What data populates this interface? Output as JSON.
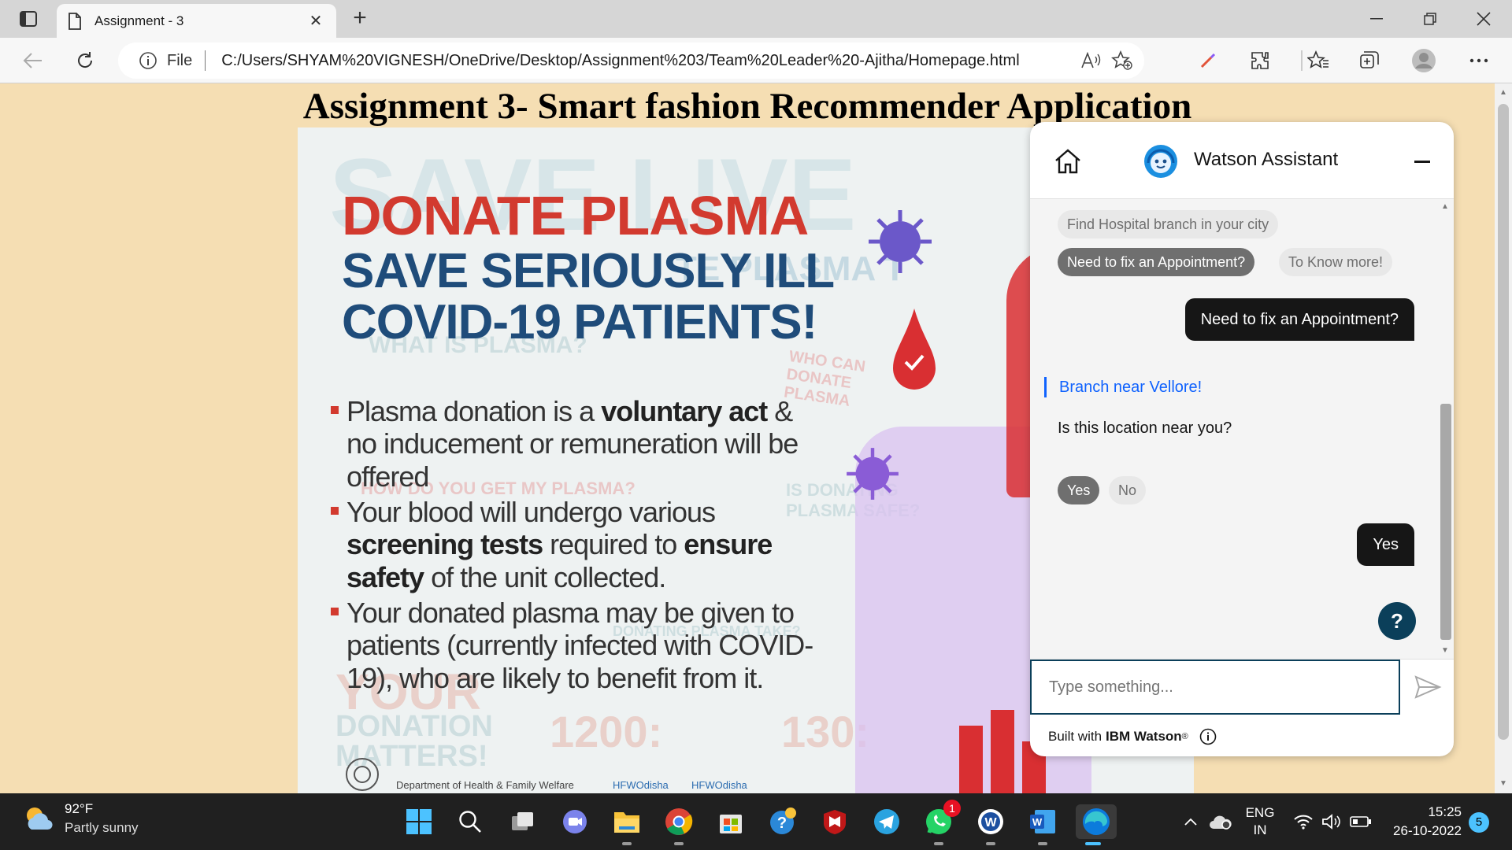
{
  "browser": {
    "tab_title": "Assignment - 3",
    "tab_close": "✕",
    "new_tab": "+",
    "file_label": "File",
    "url": "C:/Users/SHYAM%20VIGNESH/OneDrive/Desktop/Assignment%203/Team%20Leader%20-Ajitha/Homepage.html"
  },
  "page": {
    "title": "Assignment 3- Smart fashion Recommender Application"
  },
  "poster": {
    "bg_word": "SAVE LIVE",
    "headline_1": "DONATE PLASMA",
    "headline_2_line1": "SAVE SERIOUSLY ILL",
    "headline_2_line2": "COVID-19 PATIENTS!",
    "faded_1": "WHAT IS PLASMA?",
    "faded_2": "HOW DO YOU GET MY PLASMA?",
    "faded_3": "WHO CAN DONATE PLASMA",
    "faded_4": "IS DONATING PLASMA SAFE?",
    "faded_5": "YOUR",
    "faded_6": "DONATION",
    "faded_7": "MATTERS!",
    "faded_8": "1200:",
    "faded_9": "130:",
    "faded_10": "TE PLASMA T",
    "faded_11": "DONATING PLASMA TAKE?",
    "bullet_1_a": "Plasma donation is a ",
    "bullet_1_b": "voluntary act",
    "bullet_1_c": " & no inducement or remuneration will be offered",
    "bullet_2_a": "Your blood will undergo various ",
    "bullet_2_b": "screening tests",
    "bullet_2_c": " required to ",
    "bullet_2_d": "ensure safety",
    "bullet_2_e": " of the unit collected.",
    "bullet_3": "Your donated plasma may be given to patients (currently infected with COVID-19), who are likely to benefit from it.",
    "footer_dept": "Department of Health & Family Welfare",
    "footer_social_1": "HFWOdisha",
    "footer_social_2": "HFWOdisha"
  },
  "watson": {
    "title": "Watson Assistant",
    "chip_find": "Find Hospital branch in your city",
    "chip_appointment": "Need to fix an Appointment?",
    "chip_know_more": "To Know more!",
    "user_msg_1": "Need to fix an Appointment?",
    "bot_link": "Branch near Vellore!",
    "bot_question": "Is this location near you?",
    "chip_yes": "Yes",
    "chip_no": "No",
    "user_msg_2": "Yes",
    "help": "?",
    "input_placeholder": "Type something...",
    "footer_prefix": "Built with",
    "footer_brand": "IBM Watson",
    "footer_reg": "®"
  },
  "taskbar": {
    "temperature": "92°F",
    "condition": "Partly sunny",
    "whatsapp_badge": "1",
    "lang_1": "ENG",
    "lang_2": "IN",
    "time": "15:25",
    "date": "26-10-2022",
    "notifications": "5"
  },
  "colors": {
    "page_bg": "#f5deb3",
    "watson_accent": "#0f62fe",
    "watson_dark": "#0b3f5a",
    "poster_red": "#d23a2f",
    "poster_blue": "#1f4c7a"
  }
}
